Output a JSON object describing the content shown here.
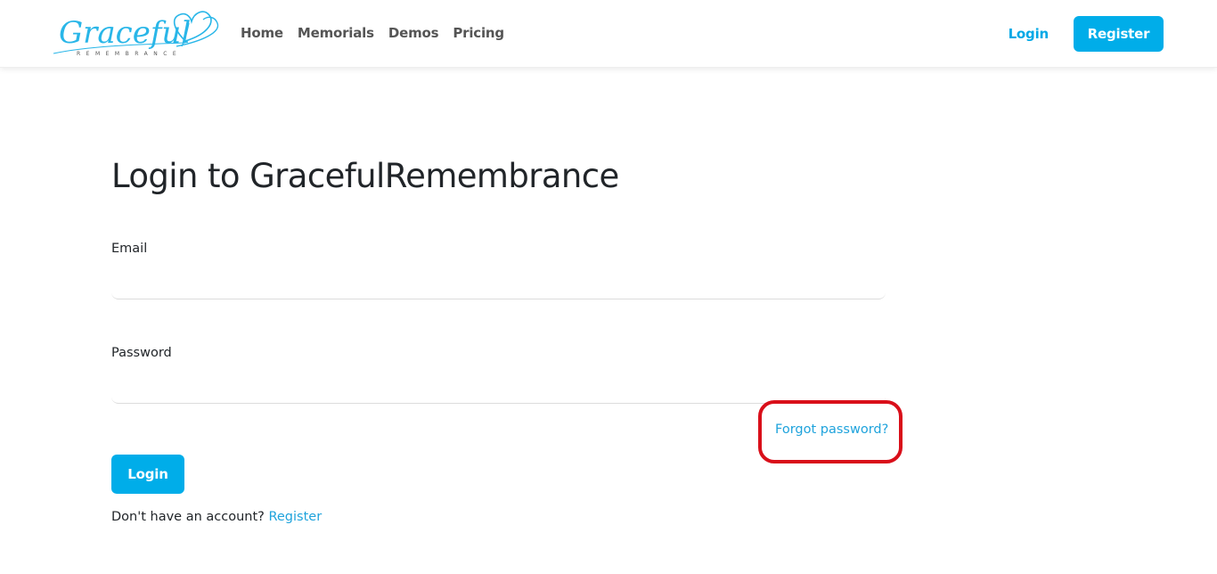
{
  "brand": {
    "name": "Graceful",
    "tagline": "REMEMBRANCE",
    "accent_color": "#00ade9",
    "logo_icon": "heart-outline-icon"
  },
  "nav": {
    "links": [
      {
        "label": "Home"
      },
      {
        "label": "Memorials"
      },
      {
        "label": "Demos"
      },
      {
        "label": "Pricing"
      }
    ],
    "login_label": "Login",
    "register_label": "Register"
  },
  "login_form": {
    "title": "Login to GracefulRemembrance",
    "email_label": "Email",
    "email_value": "",
    "password_label": "Password",
    "password_value": "",
    "forgot_password_label": "Forgot password?",
    "submit_label": "Login",
    "no_account_text": "Don't have an account?",
    "register_link_label": "Register"
  },
  "annotation": {
    "highlight_color": "#d90f1a",
    "highlighted_element": "Forgot password?"
  }
}
